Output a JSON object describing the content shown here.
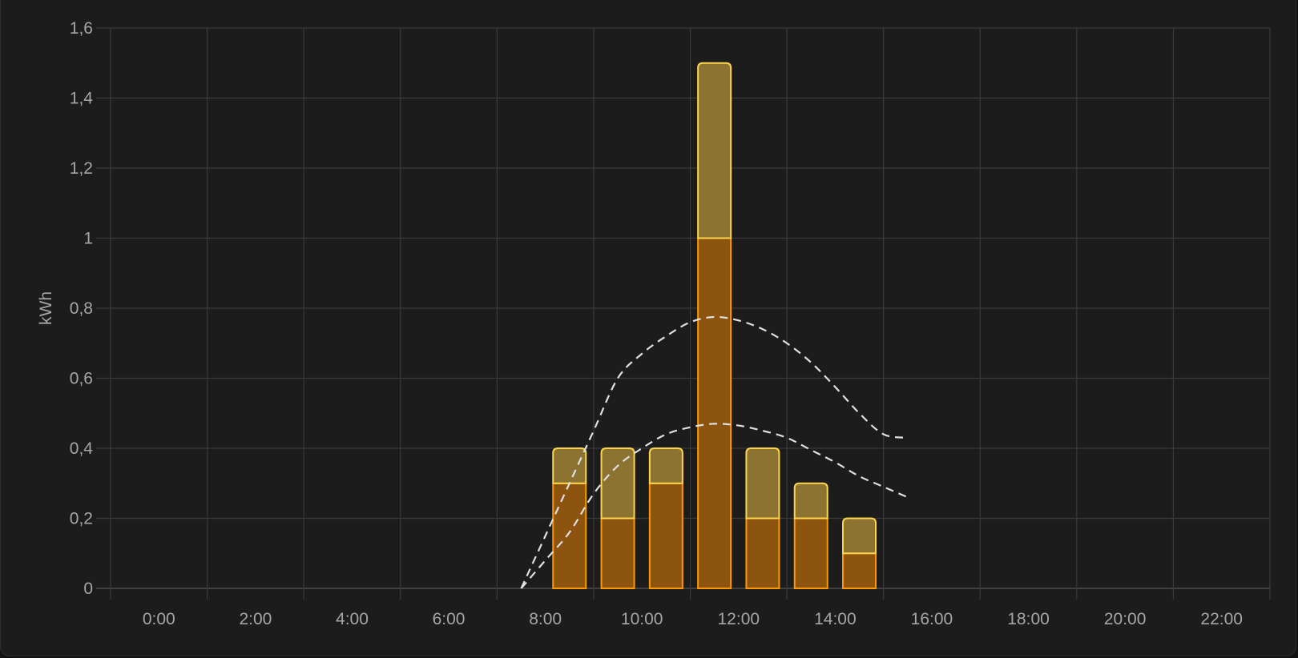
{
  "chart_data": {
    "type": "bar",
    "stacked": true,
    "xlabel": "",
    "ylabel": "kWh",
    "ylim": [
      0,
      1.6
    ],
    "xlim": [
      -0.5,
      23.5
    ],
    "grid": true,
    "x_tick_labels": [
      "0:00",
      "2:00",
      "4:00",
      "6:00",
      "8:00",
      "10:00",
      "12:00",
      "14:00",
      "16:00",
      "18:00",
      "20:00",
      "22:00"
    ],
    "y_tick_labels": [
      "0",
      "0,2",
      "0,4",
      "0,6",
      "0,8",
      "1",
      "1,2",
      "1,4",
      "1,6"
    ],
    "hours": [
      9,
      10,
      11,
      12,
      13,
      14,
      15
    ],
    "series": [
      {
        "values": [
          0.3,
          0.2,
          0.3,
          1.0,
          0.2,
          0.2,
          0.1
        ],
        "color": "#ff9800",
        "fill": "#8c540e"
      },
      {
        "values": [
          0.1,
          0.2,
          0.1,
          0.5,
          0.2,
          0.1,
          0.1
        ],
        "color": "#fdd54f",
        "fill": "#8c7331"
      }
    ],
    "forecast_lines": [
      {
        "style": "dashed",
        "color": "#e0e0e0",
        "x": [
          8.0,
          8.5,
          9.0,
          9.5,
          10.0,
          10.5,
          11.0,
          11.5,
          12.0,
          12.5,
          13.0,
          13.5,
          14.0,
          14.5,
          15.0,
          15.5,
          16.0
        ],
        "y": [
          0.0,
          0.15,
          0.3,
          0.45,
          0.6,
          0.67,
          0.72,
          0.76,
          0.775,
          0.765,
          0.74,
          0.7,
          0.645,
          0.575,
          0.5,
          0.44,
          0.43
        ]
      },
      {
        "style": "dashed",
        "color": "#e0e0e0",
        "x": [
          8.0,
          8.5,
          9.0,
          9.5,
          10.0,
          10.5,
          11.0,
          11.5,
          12.0,
          12.5,
          13.0,
          13.5,
          14.0,
          14.5,
          15.0,
          15.5,
          16.0
        ],
        "y": [
          0.0,
          0.08,
          0.16,
          0.27,
          0.35,
          0.4,
          0.44,
          0.46,
          0.47,
          0.465,
          0.45,
          0.43,
          0.395,
          0.36,
          0.32,
          0.29,
          0.26
        ]
      }
    ]
  }
}
